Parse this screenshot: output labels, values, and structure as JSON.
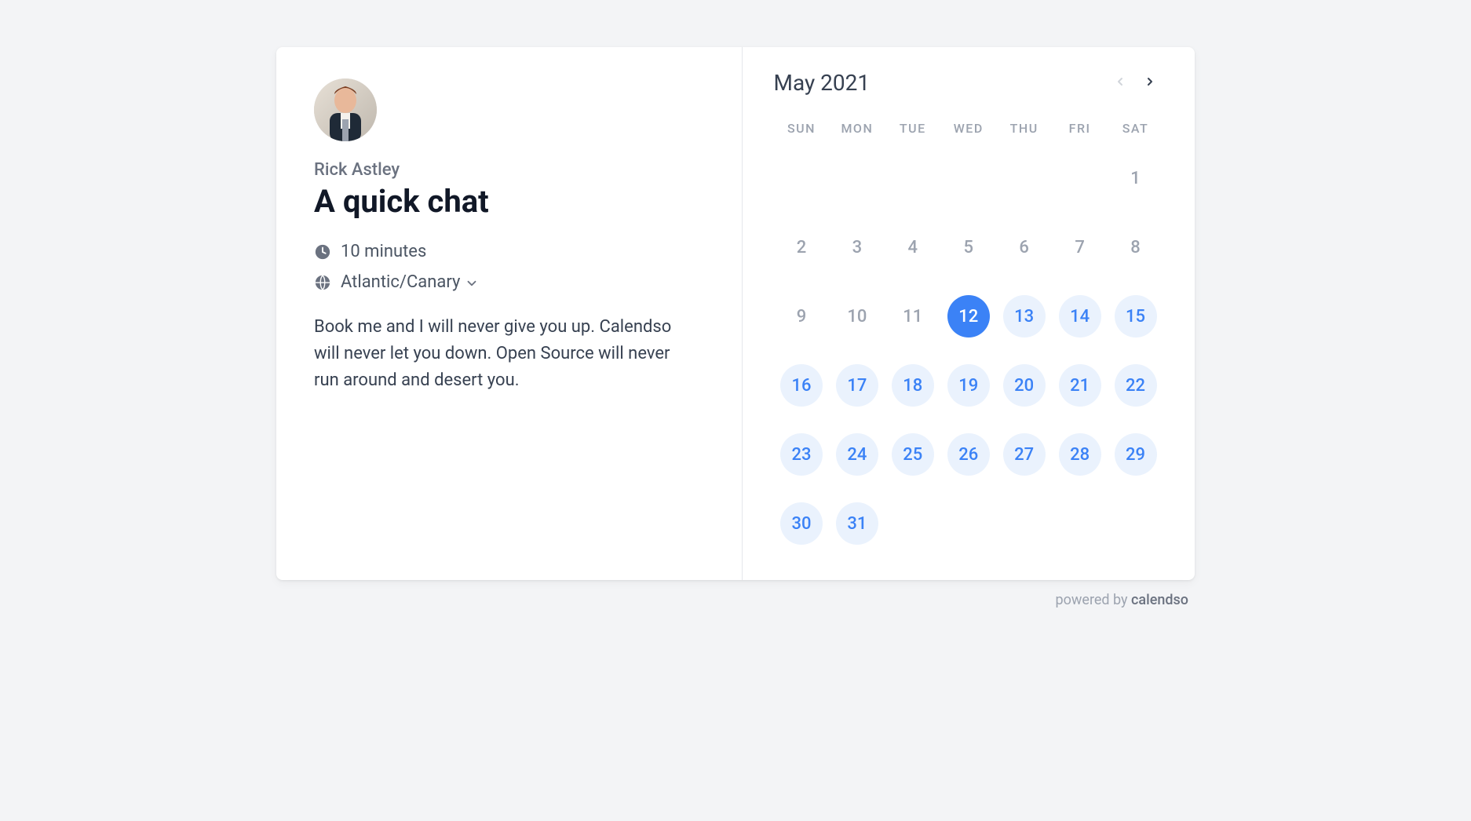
{
  "host": {
    "name": "Rick Astley"
  },
  "event": {
    "title": "A quick chat",
    "duration": "10 minutes",
    "timezone": "Atlantic/Canary",
    "description": "Book me and I will never give you up. Calendso will never let you down. Open Source will never run around and desert you."
  },
  "calendar": {
    "month_label": "May 2021",
    "weekdays": [
      "SUN",
      "MON",
      "TUE",
      "WED",
      "THU",
      "FRI",
      "SAT"
    ],
    "prev_enabled": false,
    "next_enabled": true,
    "days": [
      {
        "d": "",
        "state": "empty"
      },
      {
        "d": "",
        "state": "empty"
      },
      {
        "d": "",
        "state": "empty"
      },
      {
        "d": "",
        "state": "empty"
      },
      {
        "d": "",
        "state": "empty"
      },
      {
        "d": "",
        "state": "empty"
      },
      {
        "d": "1",
        "state": "past"
      },
      {
        "d": "2",
        "state": "past"
      },
      {
        "d": "3",
        "state": "past"
      },
      {
        "d": "4",
        "state": "past"
      },
      {
        "d": "5",
        "state": "past"
      },
      {
        "d": "6",
        "state": "past"
      },
      {
        "d": "7",
        "state": "past"
      },
      {
        "d": "8",
        "state": "past"
      },
      {
        "d": "9",
        "state": "past"
      },
      {
        "d": "10",
        "state": "past"
      },
      {
        "d": "11",
        "state": "past"
      },
      {
        "d": "12",
        "state": "selected"
      },
      {
        "d": "13",
        "state": "available"
      },
      {
        "d": "14",
        "state": "available"
      },
      {
        "d": "15",
        "state": "available"
      },
      {
        "d": "16",
        "state": "available"
      },
      {
        "d": "17",
        "state": "available"
      },
      {
        "d": "18",
        "state": "available"
      },
      {
        "d": "19",
        "state": "available"
      },
      {
        "d": "20",
        "state": "available"
      },
      {
        "d": "21",
        "state": "available"
      },
      {
        "d": "22",
        "state": "available"
      },
      {
        "d": "23",
        "state": "available"
      },
      {
        "d": "24",
        "state": "available"
      },
      {
        "d": "25",
        "state": "available"
      },
      {
        "d": "26",
        "state": "available"
      },
      {
        "d": "27",
        "state": "available"
      },
      {
        "d": "28",
        "state": "available"
      },
      {
        "d": "29",
        "state": "available"
      },
      {
        "d": "30",
        "state": "available"
      },
      {
        "d": "31",
        "state": "available"
      }
    ]
  },
  "footer": {
    "prefix": "powered by ",
    "brand": "calendso"
  }
}
